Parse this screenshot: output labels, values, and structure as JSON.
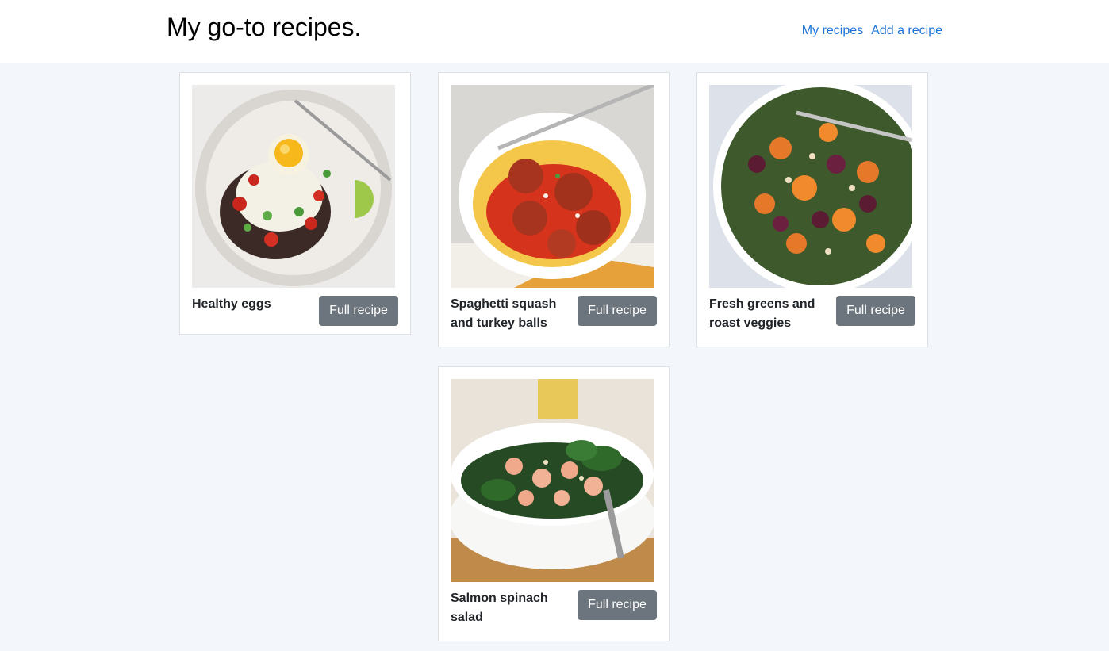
{
  "header": {
    "title": "My go-to recipes.",
    "nav": [
      "My recipes",
      "Add a recipe"
    ]
  },
  "recipes": [
    {
      "title": "Healthy eggs",
      "button": "Full recipe",
      "image": "eggs-plate-image"
    },
    {
      "title": "Spaghetti squash and turkey balls",
      "button": "Full recipe",
      "image": "meatballs-bowl-image"
    },
    {
      "title": "Fresh greens and roast veggies",
      "button": "Full recipe",
      "image": "veggie-salad-image"
    },
    {
      "title": "Salmon spinach salad",
      "button": "Full recipe",
      "image": "salmon-salad-image"
    }
  ],
  "colors": {
    "background": "#f3f7fb",
    "link": "#1a73d9",
    "button": "#6c757d"
  }
}
